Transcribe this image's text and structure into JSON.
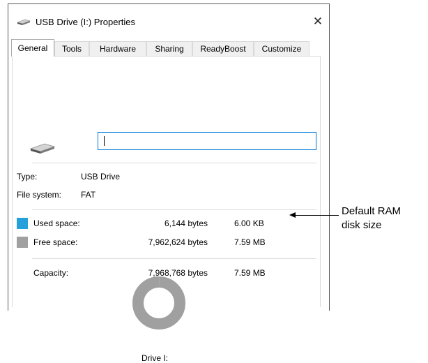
{
  "window": {
    "title": "USB Drive (I:) Properties",
    "close_glyph": "✕"
  },
  "tabs": [
    {
      "label": "General",
      "active": true
    },
    {
      "label": "Tools"
    },
    {
      "label": "Hardware"
    },
    {
      "label": "Sharing"
    },
    {
      "label": "ReadyBoost"
    },
    {
      "label": "Customize"
    }
  ],
  "drive_name_value": "",
  "info": {
    "type_label": "Type:",
    "type_value": "USB Drive",
    "fs_label": "File system:",
    "fs_value": "FAT"
  },
  "space": {
    "used": {
      "label": "Used space:",
      "bytes": "6,144 bytes",
      "size": "6.00 KB",
      "color": "#26a0da"
    },
    "free": {
      "label": "Free space:",
      "bytes": "7,962,624 bytes",
      "size": "7.59 MB",
      "color": "#a0a0a0"
    },
    "capacity": {
      "label": "Capacity:",
      "bytes": "7,968,768 bytes",
      "size": "7.59 MB"
    }
  },
  "chart_data": {
    "type": "pie",
    "categories": [
      "Used space",
      "Free space"
    ],
    "values": [
      6144,
      7962624
    ]
  },
  "drive_caption": "Drive I:",
  "annotation": {
    "line1": "Default RAM",
    "line2": "disk size"
  }
}
